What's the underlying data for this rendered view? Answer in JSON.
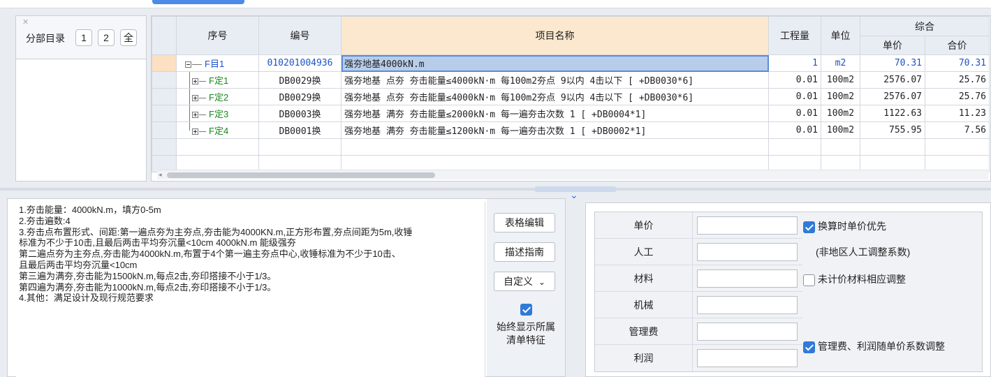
{
  "directory": {
    "title": "分部目录",
    "buttons": [
      "1",
      "2",
      "全"
    ]
  },
  "grid": {
    "headers": {
      "seq": "序号",
      "code": "编号",
      "name": "项目名称",
      "qty": "工程量",
      "unit": "单位",
      "composite": "综合",
      "unit_price": "单价",
      "total": "合价"
    },
    "rows": [
      {
        "seq": "F目1",
        "code": "010201004936",
        "name": "强夯地基4000kN.m",
        "qty": "1",
        "unit": "m2",
        "unit_price": "70.31",
        "total": "70.31"
      },
      {
        "seq": "F定1",
        "code": "DB0029换",
        "name": "强夯地基  点夯 夯击能量≤4000kN·m 每100m2夯点 9以内 4击以下 [ +DB0030*6]",
        "qty": "0.01",
        "unit": "100m2",
        "unit_price": "2576.07",
        "total": "25.76"
      },
      {
        "seq": "F定2",
        "code": "DB0029换",
        "name": "强夯地基  点夯 夯击能量≤4000kN·m 每100m2夯点 9以内 4击以下 [ +DB0030*6]",
        "qty": "0.01",
        "unit": "100m2",
        "unit_price": "2576.07",
        "total": "25.76"
      },
      {
        "seq": "F定3",
        "code": "DB0003换",
        "name": "强夯地基 满夯 夯击能量≤2000kN·m 每一遍夯击次数 1 [ +DB0004*1]",
        "qty": "0.01",
        "unit": "100m2",
        "unit_price": "1122.63",
        "total": "11.23"
      },
      {
        "seq": "F定4",
        "code": "DB0001换",
        "name": "强夯地基 满夯 夯击能量≤1200kN·m 每一遍夯击次数 1 [ +DB0002*1]",
        "qty": "0.01",
        "unit": "100m2",
        "unit_price": "755.95",
        "total": "7.56"
      }
    ]
  },
  "description": {
    "text": "1.夯击能量：4000kN.m，填方0-5m\n2.夯击遍数:4\n3.夯击点布置形式、间距:第一遍点夯为主夯点,夯击能为4000KN.m,正方形布置,夯点间距为5m,收锤\n标准为不少于10击,且最后两击平均夯沉量<10cm 4000kN.m 能级强夯\n第二遍点夯为主夯点,夯击能为4000kN.m,布置于4个第一遍主夯点中心,收锤标准为不少于10击、\n且最后两击平均夯沉量<10cm\n第三遍为满夯,夯击能为1500kN.m,每点2击,夯印搭接不小于1/3。\n第四遍为满夯,夯击能为1000kN.m,每点2击,夯印搭接不小于1/3。\n4.其他：满足设计及现行规范要求",
    "btn_table_edit": "表格编辑",
    "btn_guide": "描述指南",
    "btn_custom": "自定义",
    "chevron": "⌄",
    "always_show_label": "始终显示所属清单特征",
    "always_show_checked": true
  },
  "coef": {
    "rows": [
      "单价",
      "人工",
      "材料",
      "机械",
      "管理费",
      "利润"
    ],
    "opt_unit_price_first": "换算时单价优先",
    "opt_unit_price_first_checked": true,
    "opt_non_region": "(非地区人工调整系数)",
    "opt_unpriced_material": "未计价材料相应调整",
    "opt_unpriced_material_checked": false,
    "opt_mgmt_profit": "管理费、利润随单价系数调整",
    "opt_mgmt_profit_checked": true
  },
  "colors": {
    "accent": "#2f7ad8",
    "code_blue": "#1c52c9",
    "seq_green": "#17891d",
    "header_bg": "#e8edf4",
    "name_header_bg": "#fbe8cf"
  }
}
